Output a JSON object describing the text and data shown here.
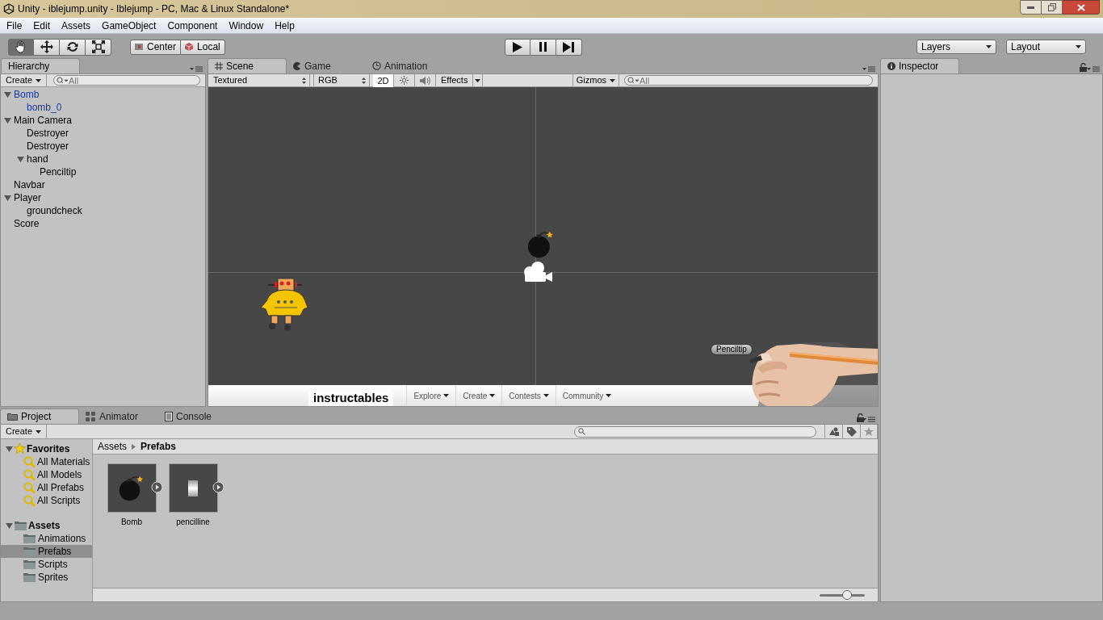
{
  "window": {
    "title": "Unity - iblejump.unity - Iblejump - PC, Mac & Linux Standalone*"
  },
  "menu": [
    "File",
    "Edit",
    "Assets",
    "GameObject",
    "Component",
    "Window",
    "Help"
  ],
  "toolbar": {
    "tools": [
      {
        "kind": "hand",
        "selected": true
      },
      {
        "kind": "move",
        "selected": false
      },
      {
        "kind": "rotate",
        "selected": false
      },
      {
        "kind": "scale",
        "selected": false
      }
    ],
    "pivot": [
      "Center",
      "Local"
    ],
    "layers": "Layers",
    "layout": "Layout"
  },
  "hierarchy": {
    "tab": "Hierarchy",
    "create": "Create",
    "search_placeholder": "All",
    "items": [
      {
        "name": "Bomb",
        "prefab": true,
        "expanded": true,
        "children": [
          {
            "name": "bomb_0",
            "prefab": true
          }
        ]
      },
      {
        "name": "Main Camera",
        "prefab": false,
        "expanded": true,
        "children": [
          {
            "name": "Destroyer",
            "prefab": false
          },
          {
            "name": "Destroyer",
            "prefab": false
          },
          {
            "name": "hand",
            "prefab": false,
            "expanded": true,
            "children": [
              {
                "name": "Penciltip",
                "prefab": false
              }
            ]
          }
        ]
      },
      {
        "name": "Navbar",
        "prefab": false
      },
      {
        "name": "Player",
        "prefab": false,
        "expanded": true,
        "children": [
          {
            "name": "groundcheck",
            "prefab": false
          }
        ]
      },
      {
        "name": "Score",
        "prefab": false
      }
    ]
  },
  "scene_tabs": [
    {
      "label": "Scene",
      "kind": "scene",
      "selected": true
    },
    {
      "label": "Game",
      "kind": "game",
      "selected": false
    },
    {
      "label": "Animation",
      "kind": "animation",
      "selected": false
    }
  ],
  "scene_toolbar": {
    "shading": "Textured",
    "channel": "RGB",
    "mode_2d": {
      "label": "2D",
      "on": true
    },
    "lighting": {
      "on": false
    },
    "audio": {
      "on": false
    },
    "effects": "Effects",
    "gizmos": "Gizmos",
    "search_placeholder": "All"
  },
  "scene": {
    "gizmo_label": "Penciltip",
    "navbar": {
      "logo": "instructables",
      "links": [
        "Explore",
        "Create",
        "Contests",
        "Community"
      ]
    }
  },
  "inspector": {
    "tab": "Inspector"
  },
  "project_tabs": [
    {
      "label": "Project",
      "kind": "project",
      "selected": true
    },
    {
      "label": "Animator",
      "kind": "animator",
      "selected": false
    },
    {
      "label": "Console",
      "kind": "console",
      "selected": false
    }
  ],
  "project": {
    "create": "Create",
    "favorites": {
      "label": "Favorites",
      "items": [
        "All Materials",
        "All Models",
        "All Prefabs",
        "All Scripts"
      ]
    },
    "assets": {
      "label": "Assets",
      "folders": [
        {
          "label": "Animations",
          "selected": false
        },
        {
          "label": "Prefabs",
          "selected": true
        },
        {
          "label": "Scripts",
          "selected": false
        },
        {
          "label": "Sprites",
          "selected": false
        }
      ]
    },
    "breadcrumb": [
      "Assets",
      "Prefabs"
    ],
    "grid": [
      {
        "label": "Bomb",
        "kind": "bomb"
      },
      {
        "label": "pencilline",
        "kind": "line"
      }
    ],
    "zoom": {
      "level": 0.6
    }
  }
}
